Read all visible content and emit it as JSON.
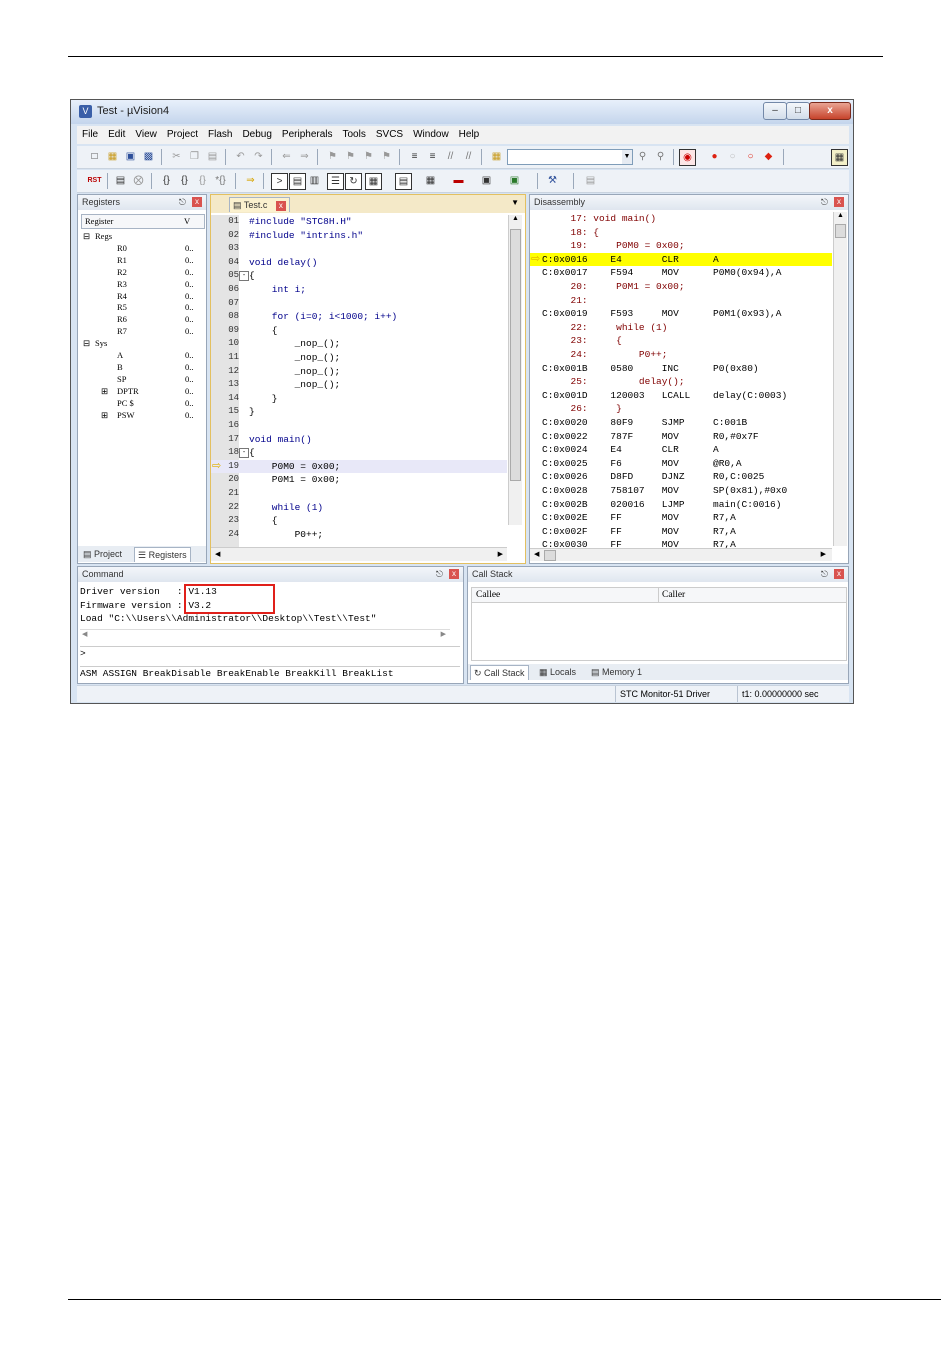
{
  "window": {
    "title": "Test - µVision4",
    "controls": [
      "–",
      "□",
      "x"
    ]
  },
  "menu": [
    "File",
    "Edit",
    "View",
    "Project",
    "Flash",
    "Debug",
    "Peripherals",
    "Tools",
    "SVCS",
    "Window",
    "Help"
  ],
  "registers": {
    "title": "Registers",
    "col_register": "Register",
    "col_value": "V",
    "regs_label": "Regs",
    "regs": [
      {
        "name": "R0",
        "value": "0.."
      },
      {
        "name": "R1",
        "value": "0.."
      },
      {
        "name": "R2",
        "value": "0.."
      },
      {
        "name": "R3",
        "value": "0.."
      },
      {
        "name": "R4",
        "value": "0.."
      },
      {
        "name": "R5",
        "value": "0.."
      },
      {
        "name": "R6",
        "value": "0.."
      },
      {
        "name": "R7",
        "value": "0.."
      }
    ],
    "sys_label": "Sys",
    "sys": [
      {
        "name": "A",
        "value": "0.."
      },
      {
        "name": "B",
        "value": "0.."
      },
      {
        "name": "SP",
        "value": "0.."
      },
      {
        "name": "DPTR",
        "value": "0.."
      },
      {
        "name": "PC $",
        "value": "0.."
      },
      {
        "name": "PSW",
        "value": "0.."
      }
    ],
    "tab_project": "Project",
    "tab_registers": "Registers"
  },
  "editor": {
    "tab": "Test.c",
    "lines": [
      {
        "n": "01",
        "t": "#include \"STC8H.H\""
      },
      {
        "n": "02",
        "t": "#include \"intrins.h\""
      },
      {
        "n": "03",
        "t": ""
      },
      {
        "n": "04",
        "t": "void delay()"
      },
      {
        "n": "05",
        "t": "{"
      },
      {
        "n": "06",
        "t": "    int i;"
      },
      {
        "n": "07",
        "t": ""
      },
      {
        "n": "08",
        "t": "    for (i=0; i<1000; i++)"
      },
      {
        "n": "09",
        "t": "    {"
      },
      {
        "n": "10",
        "t": "        _nop_();"
      },
      {
        "n": "11",
        "t": "        _nop_();"
      },
      {
        "n": "12",
        "t": "        _nop_();"
      },
      {
        "n": "13",
        "t": "        _nop_();"
      },
      {
        "n": "14",
        "t": "    }"
      },
      {
        "n": "15",
        "t": "}"
      },
      {
        "n": "16",
        "t": ""
      },
      {
        "n": "17",
        "t": "void main()"
      },
      {
        "n": "18",
        "t": "{"
      },
      {
        "n": "19",
        "t": "    P0M0 = 0x00;"
      },
      {
        "n": "20",
        "t": "    P0M1 = 0x00;"
      },
      {
        "n": "21",
        "t": ""
      },
      {
        "n": "22",
        "t": "    while (1)"
      },
      {
        "n": "23",
        "t": "    {"
      },
      {
        "n": "24",
        "t": "        P0++;"
      }
    ]
  },
  "disassembly": {
    "title": "Disassembly",
    "lines": [
      "     17: void main()",
      "     18: {",
      "     19:     P0M0 = 0x00;",
      "C:0x0016    E4       CLR      A",
      "C:0x0017    F594     MOV      P0M0(0x94),A",
      "     20:     P0M1 = 0x00;",
      "     21:",
      "C:0x0019    F593     MOV      P0M1(0x93),A",
      "     22:     while (1)",
      "     23:     {",
      "     24:         P0++;",
      "C:0x001B    0580     INC      P0(0x80)",
      "     25:         delay();",
      "C:0x001D    120003   LCALL    delay(C:0003)",
      "     26:     }",
      "C:0x0020    80F9     SJMP     C:001B",
      "C:0x0022    787F     MOV      R0,#0x7F",
      "C:0x0024    E4       CLR      A",
      "C:0x0025    F6       MOV      @R0,A",
      "C:0x0026    D8FD     DJNZ     R0,C:0025",
      "C:0x0028    758107   MOV      SP(0x81),#0x0",
      "C:0x002B    020016   LJMP     main(C:0016)",
      "C:0x002E    FF       MOV      R7,A",
      "C:0x002F    FF       MOV      R7,A",
      "C:0x0030    FF       MOV      R7,A"
    ]
  },
  "command": {
    "title": "Command",
    "output": [
      "Driver version   : V1.13",
      "Firmware version : V3.2",
      "Load \"C:\\\\Users\\\\Administrator\\\\Desktop\\\\Test\\\\Test\""
    ],
    "prompt": ">",
    "hints": "ASM ASSIGN BreakDisable BreakEnable BreakKill BreakList"
  },
  "callstack": {
    "title": "Call Stack",
    "col_callee": "Callee",
    "col_caller": "Caller",
    "tabs": [
      "Call Stack",
      "Locals",
      "Memory 1"
    ]
  },
  "status": {
    "driver": "STC Monitor-51 Driver",
    "time": "t1: 0.00000000 sec"
  },
  "colors": {
    "highlight_line": "#ffff00",
    "current_line": "#e8e8f8",
    "annotation_box": "#e0201a",
    "keyword": "#0000ff",
    "number": "#800080"
  }
}
